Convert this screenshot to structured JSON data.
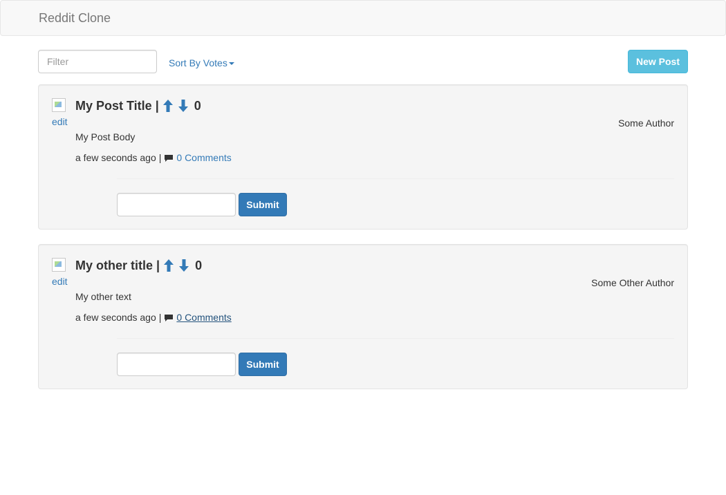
{
  "navbar": {
    "brand": "Reddit Clone"
  },
  "toolbar": {
    "filter_placeholder": "Filter",
    "sort_label": "Sort By Votes",
    "new_post_label": "New Post"
  },
  "colors": {
    "link": "#337ab7",
    "primary_button": "#337ab7",
    "info_button": "#5bc0de",
    "well_background": "#f5f5f5"
  },
  "posts": [
    {
      "title": "My Post Title",
      "separator": "|",
      "score": "0",
      "edit_label": "edit",
      "author": "Some Author",
      "body": "My Post Body",
      "time": "a few seconds ago",
      "meta_separator": "|",
      "comments_label": "0 Comments",
      "submit_label": "Submit",
      "comment_value": ""
    },
    {
      "title": "My other title",
      "separator": "|",
      "score": "0",
      "edit_label": "edit",
      "author": "Some Other Author",
      "body": "My other text",
      "time": "a few seconds ago",
      "meta_separator": "|",
      "comments_label": "0 Comments",
      "submit_label": "Submit",
      "comment_value": ""
    }
  ],
  "icons": {
    "upvote": "arrow-up-icon",
    "downvote": "arrow-down-icon",
    "comment": "comment-bubble-icon",
    "post_image": "broken-image-icon"
  }
}
